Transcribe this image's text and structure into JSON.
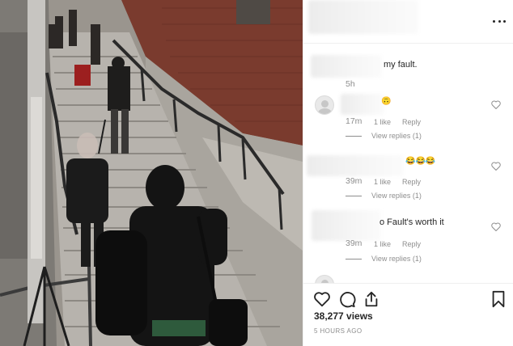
{
  "photo": {
    "description_icon": "stairs-photo"
  },
  "header": {
    "more_icon": "more-options-icon"
  },
  "comments": [
    {
      "text": "my fault.",
      "time": "5h",
      "likes": "",
      "reply": "",
      "view_replies": ""
    },
    {
      "text": "",
      "time": "17m",
      "likes": "1 like",
      "reply": "Reply",
      "view_replies": "View replies (1)"
    },
    {
      "text": "😂😂😂",
      "time": "39m",
      "likes": "1 like",
      "reply": "Reply",
      "view_replies": "View replies (1)"
    },
    {
      "text": "o Fault's worth it",
      "time": "39m",
      "likes": "1 like",
      "reply": "Reply",
      "view_replies": "View replies (1)"
    }
  ],
  "footer": {
    "views": "38,277 views",
    "ago": "5 HOURS AGO"
  },
  "colors": {
    "text": "#262626",
    "muted": "#8e8e8e",
    "border": "#efefef"
  }
}
